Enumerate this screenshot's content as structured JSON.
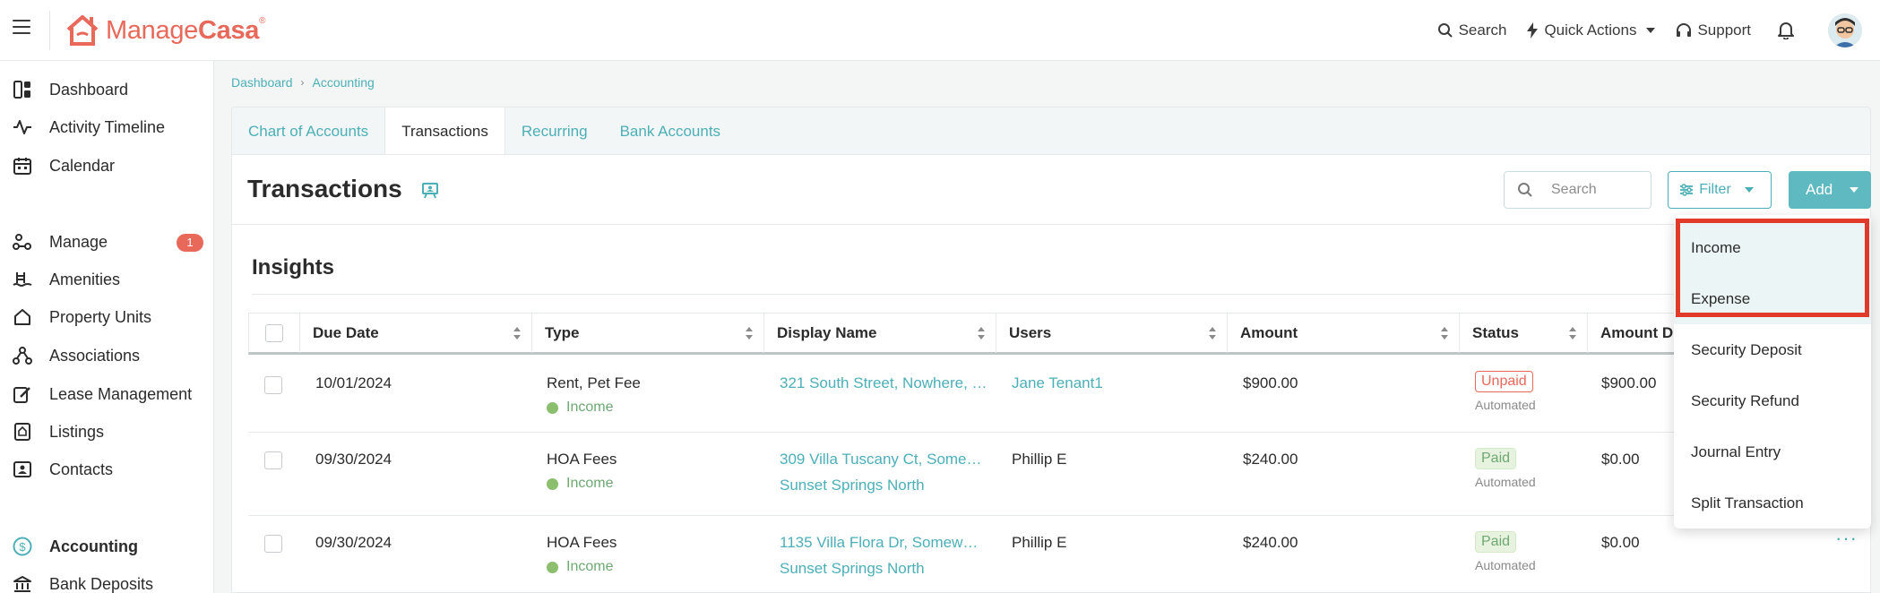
{
  "app": {
    "logo_text_light": "Manage",
    "logo_text_bold": "Casa",
    "logo_mark": "®"
  },
  "top_actions": {
    "search": "Search",
    "quick_actions": "Quick Actions",
    "support": "Support"
  },
  "sidebar": {
    "items": [
      {
        "label": "Dashboard",
        "icon": "dashboard-icon"
      },
      {
        "label": "Activity Timeline",
        "icon": "activity-icon"
      },
      {
        "label": "Calendar",
        "icon": "calendar-icon"
      },
      {
        "label": "Manage",
        "icon": "manage-icon",
        "badge": "1"
      },
      {
        "label": "Amenities",
        "icon": "amenities-icon"
      },
      {
        "label": "Property Units",
        "icon": "home-icon"
      },
      {
        "label": "Associations",
        "icon": "associations-icon"
      },
      {
        "label": "Lease Management",
        "icon": "lease-icon"
      },
      {
        "label": "Listings",
        "icon": "listings-icon"
      },
      {
        "label": "Contacts",
        "icon": "contacts-icon"
      },
      {
        "label": "Accounting",
        "icon": "dollar-icon"
      },
      {
        "label": "Bank Deposits",
        "icon": "bank-icon"
      }
    ]
  },
  "breadcrumb": {
    "items": [
      "Dashboard",
      "Accounting"
    ]
  },
  "tabs": [
    {
      "label": "Chart of Accounts",
      "active": false
    },
    {
      "label": "Transactions",
      "active": true
    },
    {
      "label": "Recurring",
      "active": false
    },
    {
      "label": "Bank Accounts",
      "active": false
    }
  ],
  "page": {
    "title": "Transactions",
    "insights": "Insights",
    "search_placeholder": "Search",
    "filter_label": "Filter",
    "add_label": "Add"
  },
  "table": {
    "columns": [
      "Due Date",
      "Type",
      "Display Name",
      "Users",
      "Amount",
      "Status",
      "Amount Du"
    ],
    "rows": [
      {
        "due": "10/01/2024",
        "type": "Rent, Pet Fee",
        "sub": "Income",
        "name": "321 South Street, Nowhere, …",
        "name2": "",
        "user": "Jane Tenant1",
        "user_link": true,
        "amount": "$900.00",
        "status": "Unpaid",
        "status_sub": "Automated",
        "due_amount": "$900.00",
        "more": ""
      },
      {
        "due": "09/30/2024",
        "type": "HOA Fees",
        "sub": "Income",
        "name": "309 Villa Tuscany Ct, Some…",
        "name2": "Sunset Springs North",
        "user": "Phillip E",
        "user_link": false,
        "amount": "$240.00",
        "status": "Paid",
        "status_sub": "Automated",
        "due_amount": "$0.00",
        "more": ""
      },
      {
        "due": "09/30/2024",
        "type": "HOA Fees",
        "sub": "Income",
        "name": "1135 Villa Flora Dr, Somew…",
        "name2": "Sunset Springs North",
        "user": "Phillip E",
        "user_link": false,
        "amount": "$240.00",
        "status": "Paid",
        "status_sub": "Automated",
        "due_amount": "$0.00",
        "more": "···"
      }
    ]
  },
  "add_menu": {
    "items": [
      "Income",
      "Expense",
      "Security Deposit",
      "Security Refund",
      "Journal Entry",
      "Split Transaction"
    ]
  },
  "colors": {
    "brand": "#e8685a",
    "accent": "#4cafb7",
    "highlight_box": "#e03a2b"
  }
}
